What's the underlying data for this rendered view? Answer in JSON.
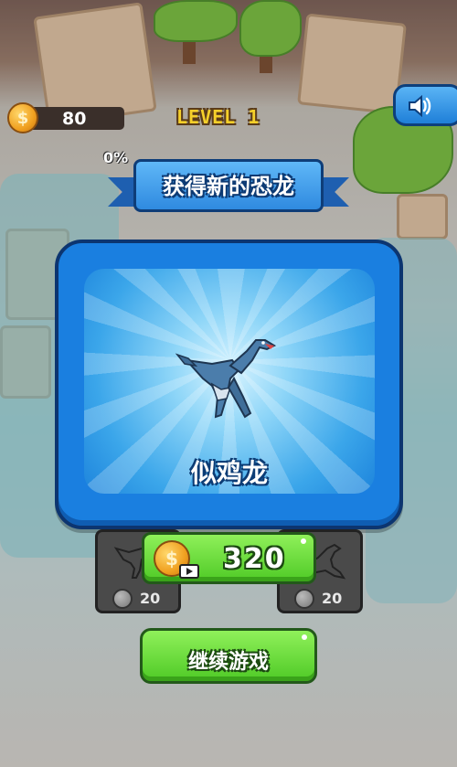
{
  "hud": {
    "coins": "80",
    "level": "LEVEL 1",
    "progress": "0%"
  },
  "banner": {
    "title": "获得新的恐龙"
  },
  "reward": {
    "dino_name": "似鸡龙"
  },
  "side_cards": [
    {
      "price": "20"
    },
    {
      "price": "20"
    }
  ],
  "buy_button": {
    "amount": "320"
  },
  "continue_button": {
    "label": "继续游戏"
  },
  "colors": {
    "panel_blue": "#1a7fe0",
    "button_green": "#4fca26",
    "level_yellow": "#f5d02a"
  },
  "icons": [
    "coin-icon",
    "sound-icon",
    "video-icon",
    "dinosaur-icon"
  ]
}
